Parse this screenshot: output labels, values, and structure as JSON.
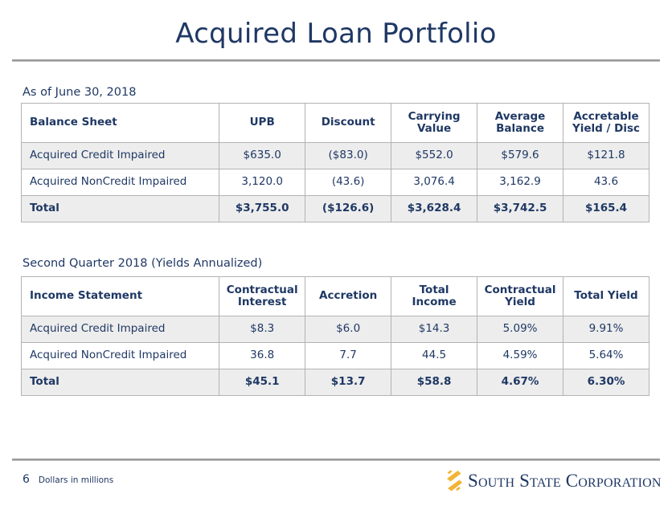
{
  "slide": {
    "title": "Acquired Loan Portfolio",
    "page_number": "6",
    "footer_note": "Dollars in millions",
    "accent_navy": "#1F3864",
    "accent_gold": "#F2B434",
    "rule_gray": "#8b8b8b",
    "shaded_row_bg": "#ededed"
  },
  "logo": {
    "mark_name": "south-state-s-mark",
    "text": "South State Corporation",
    "mark_color": "#F2B434"
  },
  "balance_section": {
    "caption": "As of June 30, 2018",
    "table": {
      "headers": [
        {
          "line1": "Balance Sheet",
          "line2": ""
        },
        {
          "line1": "UPB",
          "line2": ""
        },
        {
          "line1": "Discount",
          "line2": ""
        },
        {
          "line1": "Carrying",
          "line2": "Value"
        },
        {
          "line1": "Average",
          "line2": "Balance"
        },
        {
          "line1": "Accretable",
          "line2": "Yield / Disc"
        }
      ],
      "rows": [
        {
          "style": "shaded",
          "cells": [
            "Acquired Credit Impaired",
            "$635.0",
            "($83.0)",
            "$552.0",
            "$579.6",
            "$121.8"
          ]
        },
        {
          "style": "plain",
          "cells": [
            "Acquired NonCredit Impaired",
            "3,120.0",
            "(43.6)",
            "3,076.4",
            "3,162.9",
            "43.6"
          ]
        },
        {
          "style": "total",
          "cells": [
            "Total",
            "$3,755.0",
            "($126.6)",
            "$3,628.4",
            "$3,742.5",
            "$165.4"
          ]
        }
      ]
    }
  },
  "income_section": {
    "caption": "Second Quarter 2018 (Yields Annualized)",
    "table": {
      "headers": [
        {
          "line1": "Income Statement",
          "line2": ""
        },
        {
          "line1": "Contractual",
          "line2": "Interest"
        },
        {
          "line1": "Accretion",
          "line2": ""
        },
        {
          "line1": "Total",
          "line2": "Income"
        },
        {
          "line1": "Contractual",
          "line2": "Yield"
        },
        {
          "line1": "Total Yield",
          "line2": ""
        }
      ],
      "rows": [
        {
          "style": "shaded",
          "cells": [
            "Acquired Credit Impaired",
            "$8.3",
            "$6.0",
            "$14.3",
            "5.09%",
            "9.91%"
          ]
        },
        {
          "style": "plain",
          "cells": [
            "Acquired NonCredit Impaired",
            "36.8",
            "7.7",
            "44.5",
            "4.59%",
            "5.64%"
          ]
        },
        {
          "style": "total",
          "cells": [
            "Total",
            "$45.1",
            "$13.7",
            "$58.8",
            "4.67%",
            "6.30%"
          ]
        }
      ]
    }
  }
}
